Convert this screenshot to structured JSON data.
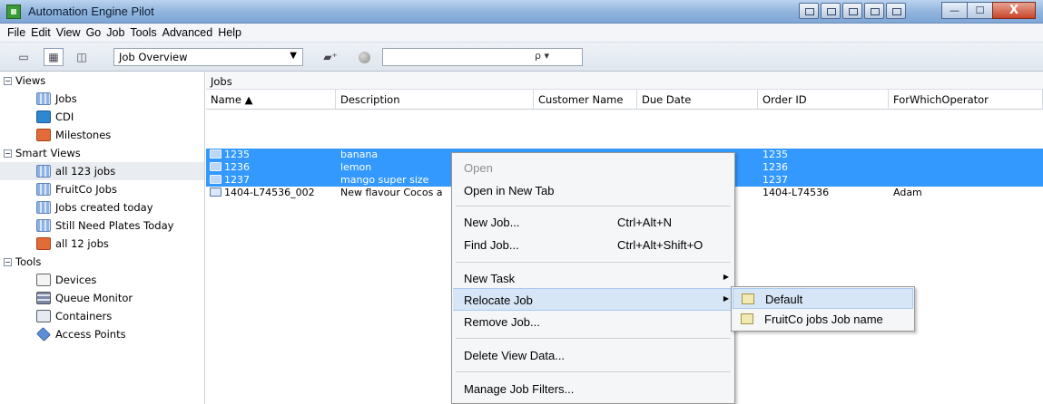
{
  "window": {
    "title": "Automation Engine Pilot",
    "buttons": {
      "minimize": "—",
      "maximize": "☐",
      "close": "X"
    }
  },
  "menubar": [
    "File",
    "Edit",
    "View",
    "Go",
    "Job",
    "Tools",
    "Advanced",
    "Help"
  ],
  "toolbar": {
    "view_select": "Job Overview",
    "search_glyph": "ρ ▾"
  },
  "sidebar": {
    "views_label": "Views",
    "views": [
      "Jobs",
      "CDI",
      "Milestones"
    ],
    "smart_views_label": "Smart Views",
    "smart_views": [
      "all 123 jobs",
      "FruitCo Jobs",
      "Jobs created today",
      "Still Need Plates Today",
      "all 12 jobs"
    ],
    "tools_label": "Tools",
    "tools": [
      "Devices",
      "Queue Monitor",
      "Containers",
      "Access Points"
    ]
  },
  "main": {
    "label": "Jobs",
    "columns": [
      "Name ▲",
      "Description",
      "Customer Name",
      "Due Date",
      "Order ID",
      "ForWhichOperator"
    ],
    "rows": [
      {
        "name": "1235",
        "description": "banana",
        "order_id": "1235",
        "operator": ""
      },
      {
        "name": "1236",
        "description": "lemon",
        "order_id": "1236",
        "operator": ""
      },
      {
        "name": "1237",
        "description": "mango super size",
        "order_id": "1237",
        "operator": ""
      },
      {
        "name": "1404-L74536_002",
        "description": "New flavour Cocos a",
        "order_id": "1404-L74536",
        "operator": "Adam"
      }
    ]
  },
  "context_menu": {
    "open": "Open",
    "open_new_tab": "Open in New Tab",
    "new_job": "New Job...",
    "new_job_shortcut": "Ctrl+Alt+N",
    "find_job": "Find Job...",
    "find_job_shortcut": "Ctrl+Alt+Shift+O",
    "new_task": "New Task",
    "relocate_job": "Relocate Job",
    "remove_job": "Remove Job...",
    "delete_view_data": "Delete View Data...",
    "manage_filters": "Manage Job Filters..."
  },
  "submenu": [
    "Default",
    "FruitCo jobs Job name"
  ]
}
